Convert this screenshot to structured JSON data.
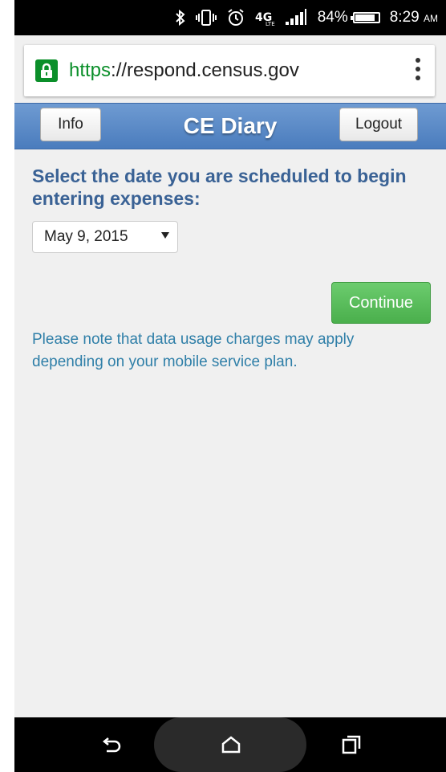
{
  "status_bar": {
    "battery": "84%",
    "time": "8:29",
    "ampm": "AM",
    "icons": [
      "bluetooth-icon",
      "vibrate-icon",
      "alarm-icon",
      "4g-lte-icon",
      "signal-icon",
      "battery-icon"
    ]
  },
  "browser": {
    "url_scheme": "https",
    "url_separator": "://",
    "url_host": "respond.census.gov"
  },
  "header": {
    "title": "CE Diary",
    "info_label": "Info",
    "logout_label": "Logout",
    "color": "#5a88c5"
  },
  "main": {
    "prompt": "Select the date you are scheduled to begin entering expenses:",
    "selected_date": "May 9, 2015",
    "continue_label": "Continue",
    "note": "Please note that data usage charges may apply depending on your mobile service plan."
  },
  "colors": {
    "prompt": "#3a6295",
    "note": "#2f7fa8",
    "continue": "#56b858",
    "secure": "#0b8f2a"
  }
}
